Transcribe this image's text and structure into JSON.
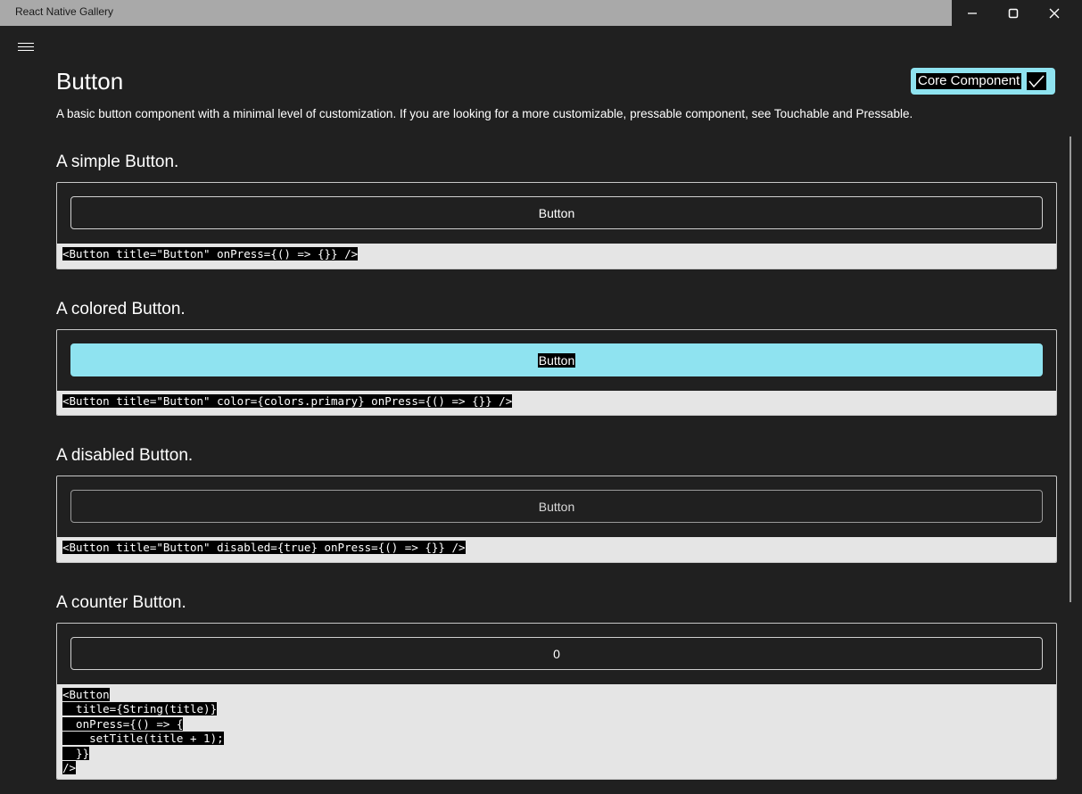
{
  "window": {
    "title": "React Native Gallery",
    "minimize_icon": "minimize-icon",
    "maximize_icon": "maximize-icon",
    "close_icon": "close-icon"
  },
  "page": {
    "title": "Button",
    "badge_label": "Core Component",
    "description": "A basic button component with a minimal level of customization. If you are looking for a more customizable, pressable component, see Touchable and Pressable."
  },
  "sections": [
    {
      "title": "A simple Button.",
      "button_label": "Button",
      "code": [
        "<Button title=\"Button\" onPress={() => {}} />"
      ]
    },
    {
      "title": "A colored Button.",
      "button_label": "Button",
      "code": [
        "<Button title=\"Button\" color={colors.primary} onPress={() => {}} />"
      ]
    },
    {
      "title": "A disabled Button.",
      "button_label": "Button",
      "code": [
        "<Button title=\"Button\" disabled={true} onPress={() => {}} />"
      ]
    },
    {
      "title": "A counter Button.",
      "button_label": "0",
      "code": [
        "<Button",
        "  title={String(title)}",
        "  onPress={() => {",
        "    setTitle(title + 1);",
        "  }}",
        "/>"
      ]
    }
  ],
  "colors": {
    "background": "#202020",
    "accent": "#8fe3f0",
    "code_background": "#e5e5e5"
  }
}
